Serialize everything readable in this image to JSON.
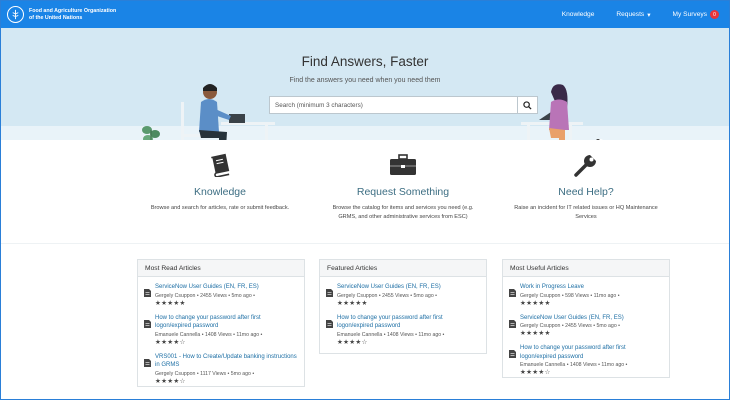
{
  "header": {
    "org_name": "Food and Agriculture Organization of the United Nations",
    "nav": {
      "knowledge": "Knowledge",
      "requests": "Requests",
      "my_surveys": "My Surveys",
      "surveys_count": "0"
    }
  },
  "hero": {
    "title": "Find Answers, Faster",
    "subtitle": "Find the answers you need when you need them",
    "search_placeholder": "Search (minimum 3 characters)"
  },
  "services": [
    {
      "title": "Knowledge",
      "description": "Browse and search for articles, rate or submit feedback."
    },
    {
      "title": "Request Something",
      "description": "Browse the catalog for items and services you need (e.g. GRMS, and other administrative services from ESC)"
    },
    {
      "title": "Need Help?",
      "description": "Raise an incident for IT related issues or HQ Maintenance Services"
    }
  ],
  "panels": [
    {
      "heading": "Most Read Articles",
      "articles": [
        {
          "title": "ServiceNow User Guides (EN, FR, ES)",
          "author": "Gergely Csuppon",
          "views": "2455 Views",
          "age": "5mo ago",
          "rating": 5
        },
        {
          "title": "How to change your password after first logon/expired password",
          "author": "Emanuele Cannella",
          "views": "1408 Views",
          "age": "11mo ago",
          "rating": 4
        },
        {
          "title": "VRS001 - How to Create/Update banking instructions in GRMS",
          "author": "Gergely Csuppon",
          "views": "1117 Views",
          "age": "5mo ago",
          "rating": 4
        }
      ]
    },
    {
      "heading": "Featured Articles",
      "articles": [
        {
          "title": "ServiceNow User Guides (EN, FR, ES)",
          "author": "Gergely Csuppon",
          "views": "2455 Views",
          "age": "5mo ago",
          "rating": 5
        },
        {
          "title": "How to change your password after first logon/expired password",
          "author": "Emanuele Cannella",
          "views": "1408 Views",
          "age": "11mo ago",
          "rating": 4
        }
      ]
    },
    {
      "heading": "Most Useful Articles",
      "articles": [
        {
          "title": "Work in Progress Leave",
          "author": "Gergely Csuppon",
          "views": "598 Views",
          "age": "11mo ago",
          "rating": 5
        },
        {
          "title": "ServiceNow User Guides (EN, FR, ES)",
          "author": "Gergely Csuppon",
          "views": "2455 Views",
          "age": "5mo ago",
          "rating": 5
        },
        {
          "title": "How to change your password after first logon/expired password",
          "author": "Emanuele Cannella",
          "views": "1408 Views",
          "age": "11mo ago",
          "rating": 4
        }
      ]
    }
  ],
  "colors": {
    "brand": "#1a84e6",
    "hero_bg": "#d4e8f3",
    "link": "#1c6ea4",
    "service_title": "#3d6e83",
    "badge": "#e8343a"
  }
}
